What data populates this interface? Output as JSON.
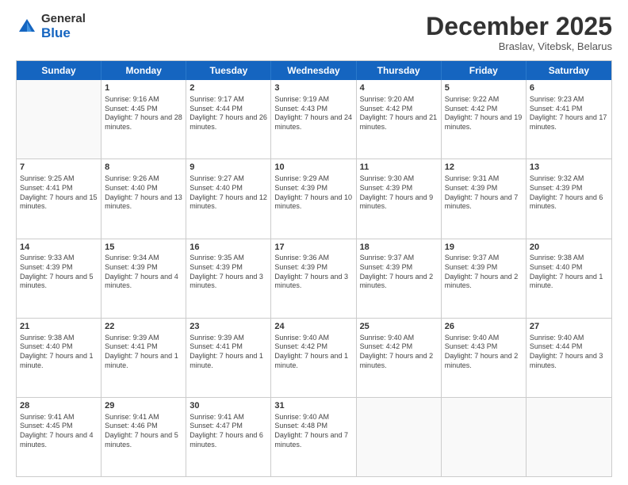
{
  "header": {
    "logo_general": "General",
    "logo_blue": "Blue",
    "month_title": "December 2025",
    "location": "Braslav, Vitebsk, Belarus"
  },
  "days_of_week": [
    "Sunday",
    "Monday",
    "Tuesday",
    "Wednesday",
    "Thursday",
    "Friday",
    "Saturday"
  ],
  "rows": [
    [
      {
        "day": "",
        "empty": true
      },
      {
        "day": "1",
        "sunrise": "Sunrise: 9:16 AM",
        "sunset": "Sunset: 4:45 PM",
        "daylight": "Daylight: 7 hours and 28 minutes."
      },
      {
        "day": "2",
        "sunrise": "Sunrise: 9:17 AM",
        "sunset": "Sunset: 4:44 PM",
        "daylight": "Daylight: 7 hours and 26 minutes."
      },
      {
        "day": "3",
        "sunrise": "Sunrise: 9:19 AM",
        "sunset": "Sunset: 4:43 PM",
        "daylight": "Daylight: 7 hours and 24 minutes."
      },
      {
        "day": "4",
        "sunrise": "Sunrise: 9:20 AM",
        "sunset": "Sunset: 4:42 PM",
        "daylight": "Daylight: 7 hours and 21 minutes."
      },
      {
        "day": "5",
        "sunrise": "Sunrise: 9:22 AM",
        "sunset": "Sunset: 4:42 PM",
        "daylight": "Daylight: 7 hours and 19 minutes."
      },
      {
        "day": "6",
        "sunrise": "Sunrise: 9:23 AM",
        "sunset": "Sunset: 4:41 PM",
        "daylight": "Daylight: 7 hours and 17 minutes."
      }
    ],
    [
      {
        "day": "7",
        "sunrise": "Sunrise: 9:25 AM",
        "sunset": "Sunset: 4:41 PM",
        "daylight": "Daylight: 7 hours and 15 minutes."
      },
      {
        "day": "8",
        "sunrise": "Sunrise: 9:26 AM",
        "sunset": "Sunset: 4:40 PM",
        "daylight": "Daylight: 7 hours and 13 minutes."
      },
      {
        "day": "9",
        "sunrise": "Sunrise: 9:27 AM",
        "sunset": "Sunset: 4:40 PM",
        "daylight": "Daylight: 7 hours and 12 minutes."
      },
      {
        "day": "10",
        "sunrise": "Sunrise: 9:29 AM",
        "sunset": "Sunset: 4:39 PM",
        "daylight": "Daylight: 7 hours and 10 minutes."
      },
      {
        "day": "11",
        "sunrise": "Sunrise: 9:30 AM",
        "sunset": "Sunset: 4:39 PM",
        "daylight": "Daylight: 7 hours and 9 minutes."
      },
      {
        "day": "12",
        "sunrise": "Sunrise: 9:31 AM",
        "sunset": "Sunset: 4:39 PM",
        "daylight": "Daylight: 7 hours and 7 minutes."
      },
      {
        "day": "13",
        "sunrise": "Sunrise: 9:32 AM",
        "sunset": "Sunset: 4:39 PM",
        "daylight": "Daylight: 7 hours and 6 minutes."
      }
    ],
    [
      {
        "day": "14",
        "sunrise": "Sunrise: 9:33 AM",
        "sunset": "Sunset: 4:39 PM",
        "daylight": "Daylight: 7 hours and 5 minutes."
      },
      {
        "day": "15",
        "sunrise": "Sunrise: 9:34 AM",
        "sunset": "Sunset: 4:39 PM",
        "daylight": "Daylight: 7 hours and 4 minutes."
      },
      {
        "day": "16",
        "sunrise": "Sunrise: 9:35 AM",
        "sunset": "Sunset: 4:39 PM",
        "daylight": "Daylight: 7 hours and 3 minutes."
      },
      {
        "day": "17",
        "sunrise": "Sunrise: 9:36 AM",
        "sunset": "Sunset: 4:39 PM",
        "daylight": "Daylight: 7 hours and 3 minutes."
      },
      {
        "day": "18",
        "sunrise": "Sunrise: 9:37 AM",
        "sunset": "Sunset: 4:39 PM",
        "daylight": "Daylight: 7 hours and 2 minutes."
      },
      {
        "day": "19",
        "sunrise": "Sunrise: 9:37 AM",
        "sunset": "Sunset: 4:39 PM",
        "daylight": "Daylight: 7 hours and 2 minutes."
      },
      {
        "day": "20",
        "sunrise": "Sunrise: 9:38 AM",
        "sunset": "Sunset: 4:40 PM",
        "daylight": "Daylight: 7 hours and 1 minute."
      }
    ],
    [
      {
        "day": "21",
        "sunrise": "Sunrise: 9:38 AM",
        "sunset": "Sunset: 4:40 PM",
        "daylight": "Daylight: 7 hours and 1 minute."
      },
      {
        "day": "22",
        "sunrise": "Sunrise: 9:39 AM",
        "sunset": "Sunset: 4:41 PM",
        "daylight": "Daylight: 7 hours and 1 minute."
      },
      {
        "day": "23",
        "sunrise": "Sunrise: 9:39 AM",
        "sunset": "Sunset: 4:41 PM",
        "daylight": "Daylight: 7 hours and 1 minute."
      },
      {
        "day": "24",
        "sunrise": "Sunrise: 9:40 AM",
        "sunset": "Sunset: 4:42 PM",
        "daylight": "Daylight: 7 hours and 1 minute."
      },
      {
        "day": "25",
        "sunrise": "Sunrise: 9:40 AM",
        "sunset": "Sunset: 4:42 PM",
        "daylight": "Daylight: 7 hours and 2 minutes."
      },
      {
        "day": "26",
        "sunrise": "Sunrise: 9:40 AM",
        "sunset": "Sunset: 4:43 PM",
        "daylight": "Daylight: 7 hours and 2 minutes."
      },
      {
        "day": "27",
        "sunrise": "Sunrise: 9:40 AM",
        "sunset": "Sunset: 4:44 PM",
        "daylight": "Daylight: 7 hours and 3 minutes."
      }
    ],
    [
      {
        "day": "28",
        "sunrise": "Sunrise: 9:41 AM",
        "sunset": "Sunset: 4:45 PM",
        "daylight": "Daylight: 7 hours and 4 minutes."
      },
      {
        "day": "29",
        "sunrise": "Sunrise: 9:41 AM",
        "sunset": "Sunset: 4:46 PM",
        "daylight": "Daylight: 7 hours and 5 minutes."
      },
      {
        "day": "30",
        "sunrise": "Sunrise: 9:41 AM",
        "sunset": "Sunset: 4:47 PM",
        "daylight": "Daylight: 7 hours and 6 minutes."
      },
      {
        "day": "31",
        "sunrise": "Sunrise: 9:40 AM",
        "sunset": "Sunset: 4:48 PM",
        "daylight": "Daylight: 7 hours and 7 minutes."
      },
      {
        "day": "",
        "empty": true
      },
      {
        "day": "",
        "empty": true
      },
      {
        "day": "",
        "empty": true
      }
    ]
  ]
}
